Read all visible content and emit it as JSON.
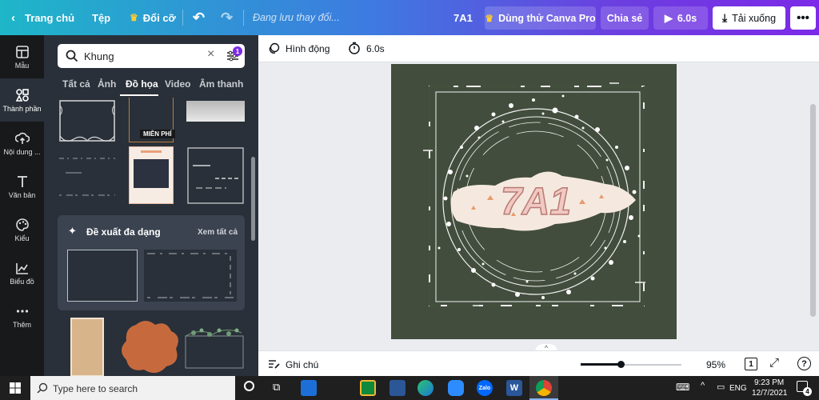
{
  "topbar": {
    "home_label": "Trang chủ",
    "file_label": "Tệp",
    "resize_label": "Đổi cỡ",
    "saving_status": "Đang lưu thay đổi...",
    "design_title": "7A1",
    "pro_trial_label": "Dùng thử Canva Pro",
    "share_label": "Chia sẻ",
    "play_duration": "6.0s",
    "download_label": "Tải xuống"
  },
  "left_rail": {
    "items": [
      {
        "label": "Mẫu",
        "icon": "templates-icon"
      },
      {
        "label": "Thành phần",
        "icon": "elements-icon"
      },
      {
        "label": "Nội dung ...",
        "icon": "upload-icon"
      },
      {
        "label": "Văn bản",
        "icon": "text-icon"
      },
      {
        "label": "Kiểu",
        "icon": "palette-icon"
      },
      {
        "label": "Biểu đồ",
        "icon": "chart-icon"
      },
      {
        "label": "Thêm",
        "icon": "more-icon"
      }
    ]
  },
  "panel": {
    "search_value": "Khung",
    "filter_badge": "1",
    "tabs": [
      "Tất cả",
      "Ảnh",
      "Đồ họa",
      "Video",
      "Âm thanh"
    ],
    "active_tab": "Đồ họa",
    "free_badge": "MIỄN PHÍ",
    "suggest_title": "Đề xuất đa dạng",
    "see_all": "Xem tất cả"
  },
  "editor": {
    "animate_label": "Hình động",
    "duration_label": "6.0s",
    "canvas_text": "7A1"
  },
  "bottom_bar": {
    "notes_label": "Ghi chú",
    "zoom_level": "95%",
    "zoom_fraction": 0.4,
    "page_count": "1"
  },
  "taskbar": {
    "search_placeholder": "Type here to search",
    "language": "ENG",
    "time": "9:23 PM",
    "date": "12/7/2021",
    "notification_count": "4",
    "zalo_label": "Zalo",
    "word_label": "W"
  },
  "colors": {
    "canvas_bg": "#434d3d",
    "panel_bg": "#293039",
    "rail_bg": "#18191b",
    "gradient_start": "#1eb6c8",
    "gradient_end": "#7c2ae8"
  }
}
